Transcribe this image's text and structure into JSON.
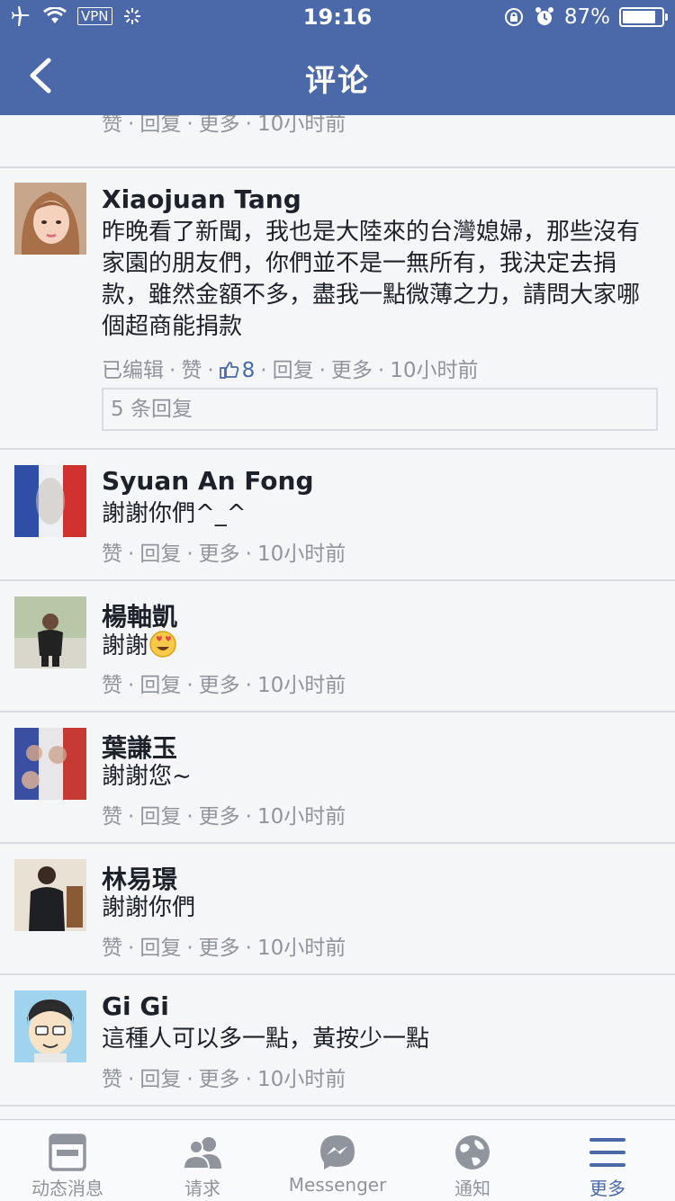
{
  "status_bar": {
    "vpn": "VPN",
    "time": "19:16",
    "battery": "87%",
    "battery_level": 0.87
  },
  "nav": {
    "title": "评论"
  },
  "actions": {
    "like": "赞",
    "reply": "回复",
    "more": "更多",
    "edited": "已编辑"
  },
  "comments": [
    {
      "time": "10小时前"
    },
    {
      "name": "Xiaojuan Tang",
      "text": "昨晚看了新聞，我也是大陸來的台灣媳婦，那些沒有家園的朋友們，你們並不是一無所有，我決定去捐款，雖然金額不多，盡我一點微薄之力，請問大家哪個超商能捐款",
      "likes": "8",
      "time": "10小时前",
      "replies": "5 条回复"
    },
    {
      "name": "Syuan An Fong",
      "text": "謝謝你們^_^",
      "time": "10小时前"
    },
    {
      "name": "楊軸凱",
      "text": "謝謝",
      "time": "10小时前"
    },
    {
      "name": "葉謙玉",
      "text": "謝謝您~",
      "time": "10小时前"
    },
    {
      "name": "林易璟",
      "text": "謝謝你們",
      "time": "10小时前"
    },
    {
      "name": "Gi Gi",
      "text": "這種人可以多一點，黃按少一點",
      "time": "10小时前"
    }
  ],
  "tabbar": [
    {
      "label": "动态消息",
      "icon": "news-feed-icon"
    },
    {
      "label": "请求",
      "icon": "friend-requests-icon"
    },
    {
      "label": "Messenger",
      "icon": "messenger-icon"
    },
    {
      "label": "通知",
      "icon": "globe-notifications-icon"
    },
    {
      "label": "更多",
      "icon": "menu-icon",
      "active": true
    }
  ],
  "colors": {
    "brand": "#4b69a8",
    "background": "#f5f6f7",
    "meta_text": "#90949c"
  }
}
